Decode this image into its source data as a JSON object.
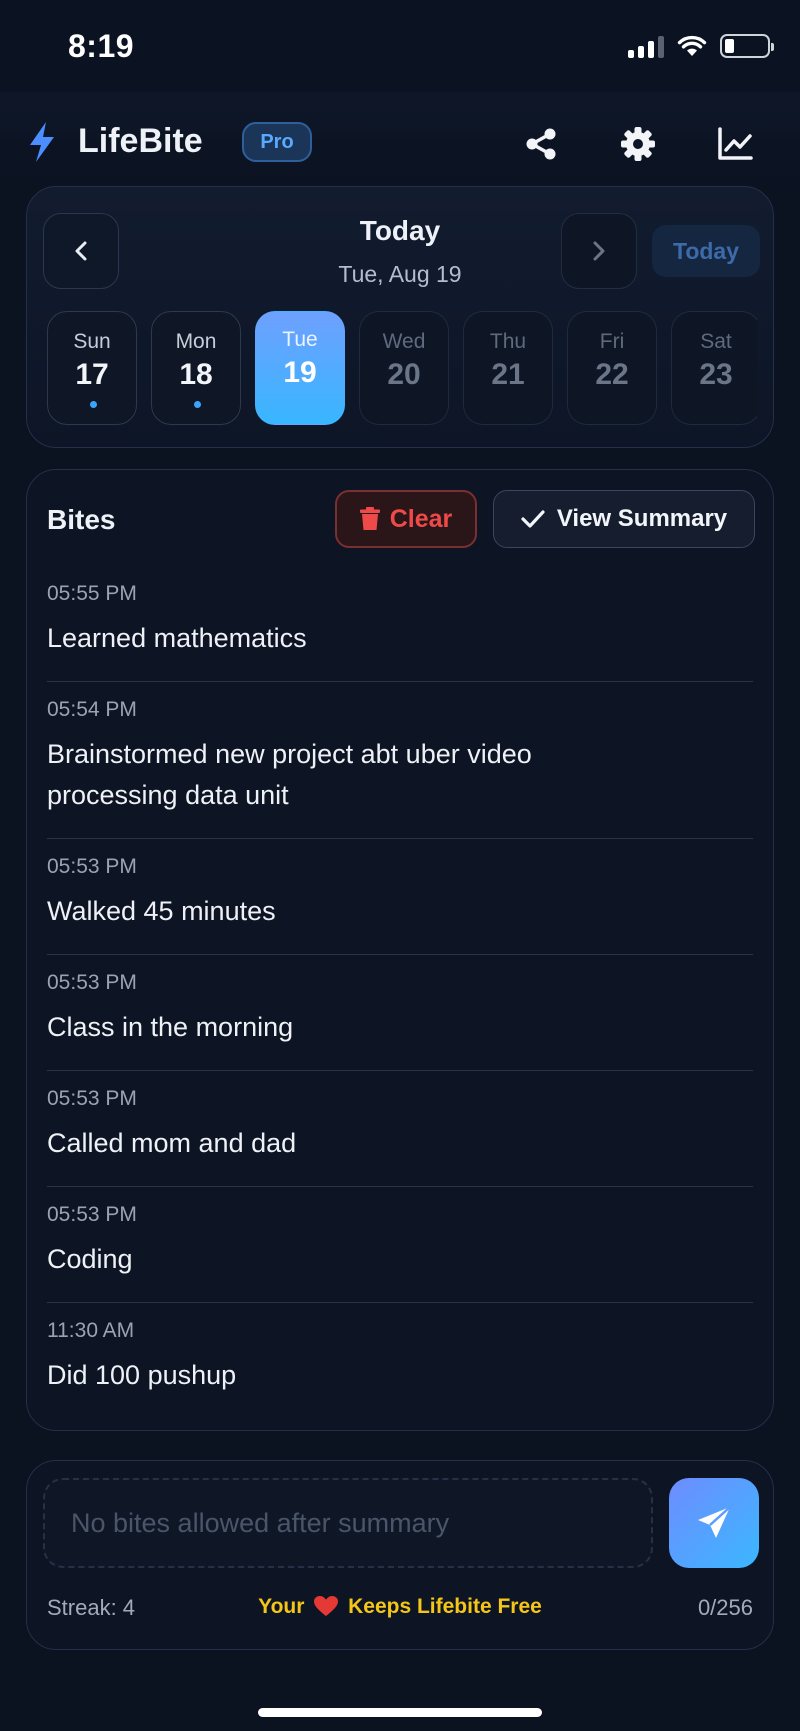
{
  "status_bar": {
    "time": "8:19"
  },
  "header": {
    "app_name": "LifeBite",
    "badge": "Pro",
    "icons": [
      "bolt-logo-icon",
      "share-icon",
      "gear-icon",
      "chart-line-icon"
    ]
  },
  "calendar": {
    "title": "Today",
    "date": "Tue, Aug 19",
    "today_button": "Today",
    "days": [
      {
        "name": "Sun",
        "num": "17",
        "has_entries": true,
        "state": "past"
      },
      {
        "name": "Mon",
        "num": "18",
        "has_entries": true,
        "state": "past"
      },
      {
        "name": "Tue",
        "num": "19",
        "has_entries": false,
        "state": "selected"
      },
      {
        "name": "Wed",
        "num": "20",
        "has_entries": false,
        "state": "future"
      },
      {
        "name": "Thu",
        "num": "21",
        "has_entries": false,
        "state": "future"
      },
      {
        "name": "Fri",
        "num": "22",
        "has_entries": false,
        "state": "future"
      },
      {
        "name": "Sat",
        "num": "23",
        "has_entries": false,
        "state": "future"
      }
    ]
  },
  "bites": {
    "title": "Bites",
    "clear_label": "Clear",
    "summary_label": "View Summary",
    "items": [
      {
        "time": "05:55 PM",
        "text": "Learned mathematics"
      },
      {
        "time": "05:54 PM",
        "text": "Brainstormed new project abt uber video processing data unit"
      },
      {
        "time": "05:53 PM",
        "text": "Walked 45 minutes"
      },
      {
        "time": "05:53 PM",
        "text": "Class in the morning"
      },
      {
        "time": "05:53 PM",
        "text": "Called mom and dad"
      },
      {
        "time": "05:53 PM",
        "text": "Coding"
      },
      {
        "time": "11:30 AM",
        "text": "Did 100 pushup"
      }
    ]
  },
  "composer": {
    "placeholder": "No bites allowed after summary",
    "streak": "Streak: 4",
    "free_msg_prefix": "Your",
    "free_msg_suffix": "Keeps Lifebite Free",
    "counter": "0/256"
  },
  "colors": {
    "accent": "#3aa5ff",
    "danger": "#ef4a4a",
    "gold": "#f5c518",
    "background": "#0b1220"
  }
}
